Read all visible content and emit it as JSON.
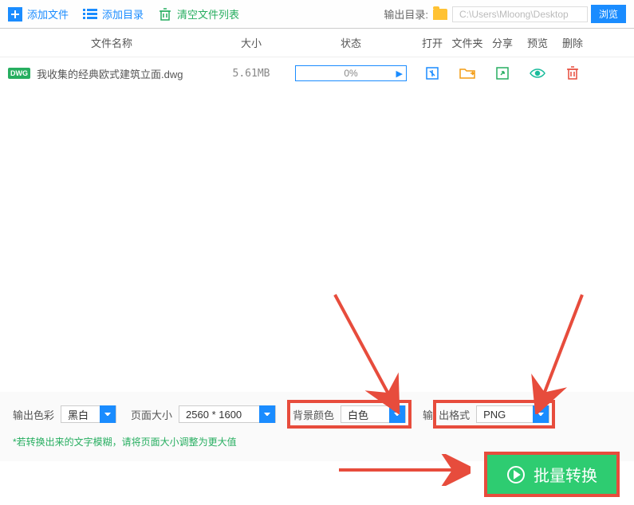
{
  "toolbar": {
    "add_file": "添加文件",
    "add_dir": "添加目录",
    "clear_list": "清空文件列表",
    "output_dir_label": "输出目录:",
    "output_path": "C:\\Users\\Mloong\\Desktop",
    "browse": "浏览"
  },
  "headers": {
    "name": "文件名称",
    "size": "大小",
    "status": "状态",
    "open": "打开",
    "folder": "文件夹",
    "share": "分享",
    "preview": "预览",
    "delete": "删除"
  },
  "files": [
    {
      "badge": "DWG",
      "name": "我收集的经典欧式建筑立面.dwg",
      "size": "5.61MB",
      "progress": "0%"
    }
  ],
  "settings": {
    "color_label": "输出色彩",
    "color_value": "黑白",
    "page_label": "页面大小",
    "page_value": "2560 * 1600",
    "bg_label": "背景颜色",
    "bg_value": "白色",
    "fmt_label": "出格式",
    "fmt_prefix": "输",
    "fmt_value": "PNG"
  },
  "hint": "若转换出来的文字模糊，请将页面大小调整为更大值",
  "convert": "批量转换"
}
